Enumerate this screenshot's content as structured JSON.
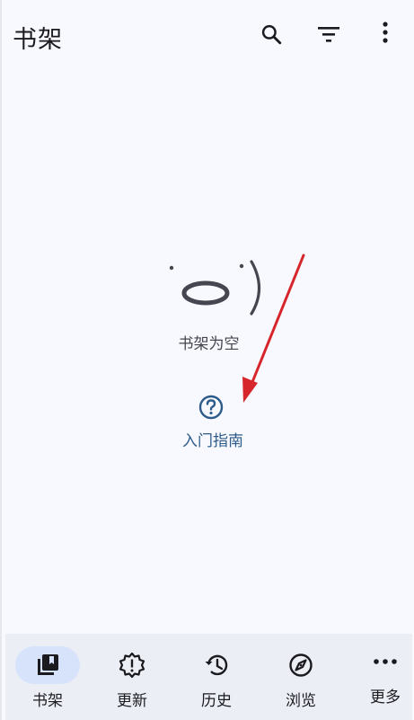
{
  "header": {
    "title": "书架",
    "icons": [
      "search-icon",
      "filter-icon",
      "more-vert-icon"
    ]
  },
  "empty_state": {
    "face": "(´ω`)",
    "message": "书架为空"
  },
  "guide": {
    "label": "入门指南",
    "icon": "help-circle-icon"
  },
  "annotation": {
    "arrow_color": "#d7262b"
  },
  "bottom_nav": {
    "items": [
      {
        "label": "书架",
        "icon": "library-books-icon",
        "active": true
      },
      {
        "label": "更新",
        "icon": "new-releases-icon",
        "active": false
      },
      {
        "label": "历史",
        "icon": "history-icon",
        "active": false
      },
      {
        "label": "浏览",
        "icon": "explore-icon",
        "active": false
      },
      {
        "label": "更多",
        "icon": "more-horiz-icon",
        "active": false
      }
    ]
  },
  "colors": {
    "background": "#f8f9fe",
    "nav_background": "#eceef6",
    "active_pill": "#d7e2fb",
    "guide_text": "#2e5c8a"
  }
}
